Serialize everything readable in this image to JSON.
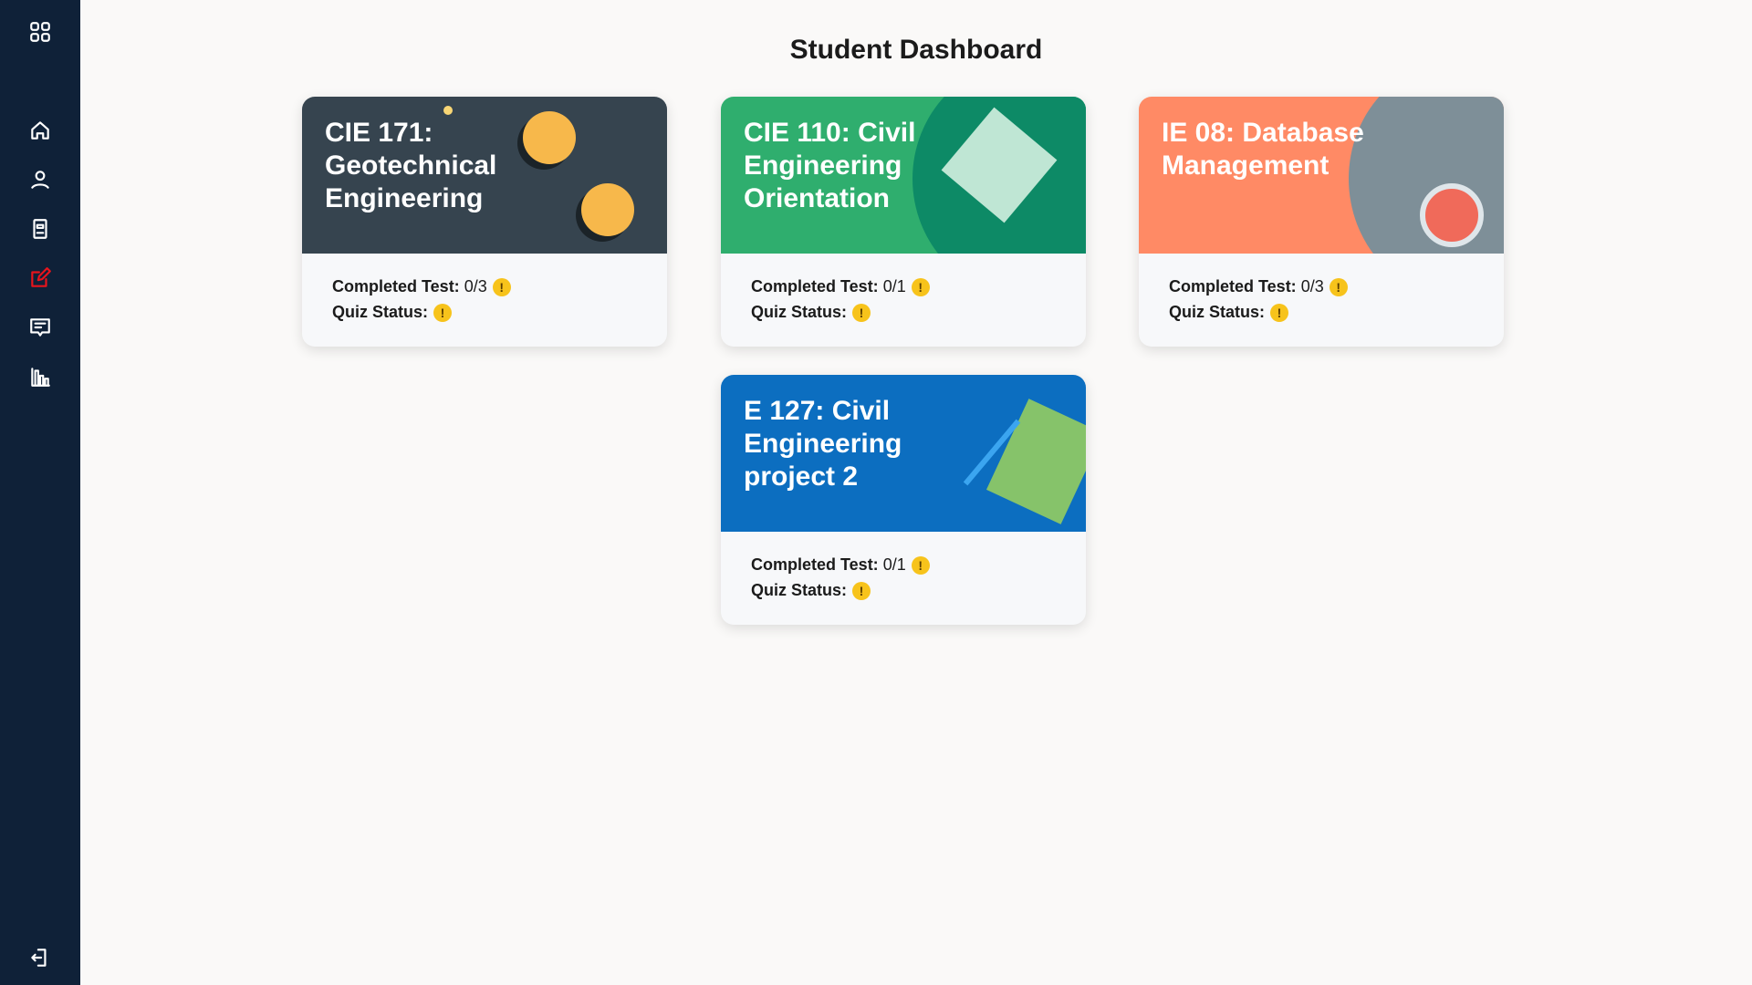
{
  "page_title": "Student Dashboard",
  "sidebar": {
    "items": [
      "apps",
      "home",
      "profile",
      "courses",
      "quizzes",
      "messages",
      "reports"
    ],
    "active": "quizzes",
    "logout": "logout"
  },
  "labels": {
    "completed": "Completed Test:",
    "quiz": "Quiz Status:",
    "warn_glyph": "!"
  },
  "courses": [
    {
      "title": "CIE 171: Geotechnical Engineering",
      "completed": "0/3",
      "color": "#36444f"
    },
    {
      "title": "CIE 110: Civil Engineering Orientation",
      "completed": "0/1",
      "color": "#2fae6e"
    },
    {
      "title": "IE 08: Database Management",
      "completed": "0/3",
      "color": "#ff8a65"
    },
    {
      "title": "E 127: Civil Engineering project 2",
      "completed": "0/1",
      "color": "#0c6ec0"
    }
  ]
}
